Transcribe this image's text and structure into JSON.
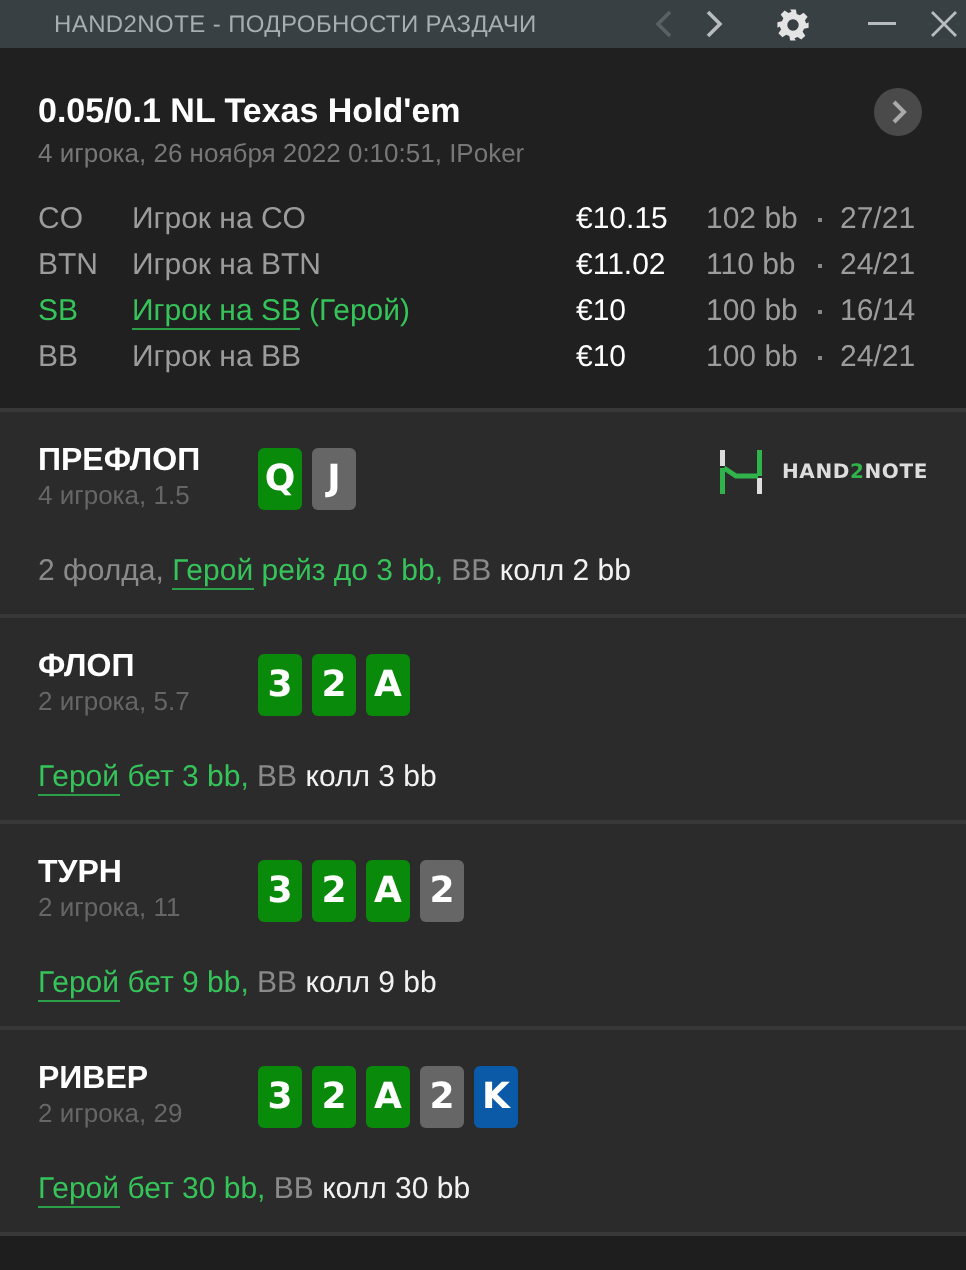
{
  "window": {
    "title": "HAND2NOTE - ПОДРОБНОСТИ РАЗДАЧИ",
    "back_disabled": true,
    "forward_disabled": false
  },
  "hand": {
    "title": "0.05/0.1 NL Texas Hold'em",
    "subtitle": "4 игрока, 26 ноября 2022 0:10:51, IPoker"
  },
  "players": [
    {
      "position": "CO",
      "name": "Игрок на CO",
      "hero": false,
      "stack": "€10.15",
      "bb": "102 bb",
      "stats": "27/21"
    },
    {
      "position": "BTN",
      "name": "Игрок на BTN",
      "hero": false,
      "stack": "€11.02",
      "bb": "110 bb",
      "stats": "24/21"
    },
    {
      "position": "SB",
      "name": "Игрок на SB",
      "hero": true,
      "hero_tag": "(Герой)",
      "stack": "€10",
      "bb": "100 bb",
      "stats": "16/14"
    },
    {
      "position": "BB",
      "name": "Игрок на BB",
      "hero": false,
      "stack": "€10",
      "bb": "100 bb",
      "stats": "24/21"
    }
  ],
  "logo": {
    "before": "HAND",
    "highlight": "2",
    "after": "NOTE"
  },
  "streets": [
    {
      "name": "ПРЕФЛОП",
      "info": "4 игрока, 1.5",
      "logo": true,
      "cards": [
        {
          "rank": "Q",
          "color": "#0a8a0a"
        },
        {
          "rank": "J",
          "color": "#666666"
        }
      ],
      "action": [
        {
          "kind": "muted",
          "text": "2 фолда,"
        },
        {
          "kind": "hero_link",
          "text": "Герой"
        },
        {
          "kind": "hero",
          "text": "рейз до 3 bb,"
        },
        {
          "kind": "muted",
          "text": "BB"
        },
        {
          "kind": "plain",
          "text": "колл 2 bb"
        }
      ]
    },
    {
      "name": "ФЛОП",
      "info": "2 игрока, 5.7",
      "logo": false,
      "cards": [
        {
          "rank": "3",
          "color": "#0a8a0a"
        },
        {
          "rank": "2",
          "color": "#0a8a0a"
        },
        {
          "rank": "A",
          "color": "#0a8a0a"
        }
      ],
      "action": [
        {
          "kind": "hero_link",
          "text": "Герой"
        },
        {
          "kind": "hero",
          "text": "бет 3 bb,"
        },
        {
          "kind": "muted",
          "text": "BB"
        },
        {
          "kind": "plain",
          "text": "колл 3 bb"
        }
      ]
    },
    {
      "name": "ТУРН",
      "info": "2 игрока, 11",
      "logo": false,
      "cards": [
        {
          "rank": "3",
          "color": "#0a8a0a"
        },
        {
          "rank": "2",
          "color": "#0a8a0a"
        },
        {
          "rank": "A",
          "color": "#0a8a0a"
        },
        {
          "rank": "2",
          "color": "#666666"
        }
      ],
      "action": [
        {
          "kind": "hero_link",
          "text": "Герой"
        },
        {
          "kind": "hero",
          "text": "бет 9 bb,"
        },
        {
          "kind": "muted",
          "text": "BB"
        },
        {
          "kind": "plain",
          "text": "колл 9 bb"
        }
      ]
    },
    {
      "name": "РИВЕР",
      "info": "2 игрока, 29",
      "logo": false,
      "cards": [
        {
          "rank": "3",
          "color": "#0a8a0a"
        },
        {
          "rank": "2",
          "color": "#0a8a0a"
        },
        {
          "rank": "A",
          "color": "#0a8a0a"
        },
        {
          "rank": "2",
          "color": "#666666"
        },
        {
          "rank": "K",
          "color": "#0b5aa8"
        }
      ],
      "action": [
        {
          "kind": "hero_link",
          "text": "Герой"
        },
        {
          "kind": "hero",
          "text": "бет 30 bb,"
        },
        {
          "kind": "muted",
          "text": "BB"
        },
        {
          "kind": "plain",
          "text": "колл 30 bb"
        }
      ]
    }
  ]
}
